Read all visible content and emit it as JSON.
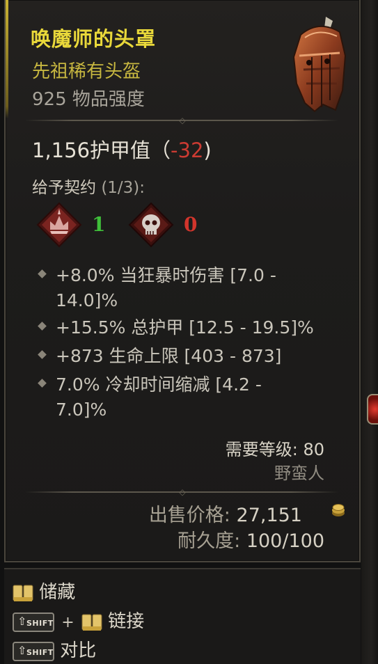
{
  "item": {
    "name": "唤魔师的头罩",
    "type": "先祖稀有头盔",
    "power": "925 物品强度",
    "armor_value": "1,156护甲值",
    "armor_paren_open": "（",
    "armor_delta": "-32",
    "armor_paren_close": ")",
    "image_icon": "helmet-icon"
  },
  "covenant": {
    "label": "给予契约",
    "count": "(1/3):",
    "badges": [
      {
        "icon": "crown-sigil-icon",
        "value": "1",
        "color": "#3fbf3a"
      },
      {
        "icon": "skull-sigil-icon",
        "value": "0",
        "color": "#d2352c"
      }
    ]
  },
  "affixes": [
    {
      "line1": "+8.0% 当狂暴时伤害 [7.0 -",
      "line2": "14.0]%"
    },
    {
      "line1": "+15.5% 总护甲 [12.5 - 19.5]%",
      "line2": ""
    },
    {
      "line1": "+873 生命上限 [403 - 873]",
      "line2": ""
    },
    {
      "line1": "7.0% 冷却时间缩减 [4.2 -",
      "line2": "7.0]%"
    }
  ],
  "requirements": {
    "level": "需要等级: 80",
    "class": "野蛮人"
  },
  "sell": {
    "label": "出售价格:",
    "value": "27,151",
    "icon": "gold-coins-icon"
  },
  "durability": {
    "label": "耐久度:",
    "value": "100/100"
  },
  "actions": {
    "stash": "储藏",
    "link": "链接",
    "compare": "对比",
    "shift_key": "SHIFT",
    "plus": "+"
  },
  "colors": {
    "legendary_name": "#e9d83a",
    "rare_type": "#c7b740",
    "negative": "#cc3b32"
  }
}
